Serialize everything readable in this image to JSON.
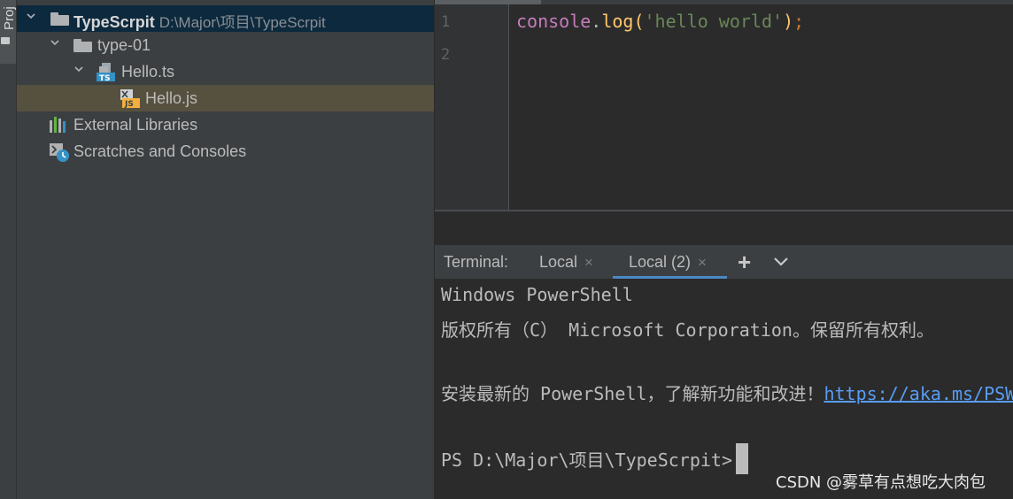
{
  "tool_window_tab": {
    "label": "Proj"
  },
  "project_tree": {
    "root": {
      "name": "TypeScrpit",
      "path": "D:\\Major\\项目\\TypeScrpit"
    },
    "folder": {
      "name": "type-01"
    },
    "ts_file": {
      "name": "Hello.ts",
      "badge": "TS"
    },
    "js_file": {
      "name": "Hello.js",
      "badge": "JS"
    },
    "external_libraries": "External Libraries",
    "scratches": "Scratches and Consoles"
  },
  "editor": {
    "line_numbers": [
      "1",
      "2"
    ],
    "code_tokens": {
      "obj": "console",
      "dot": ".",
      "fn": "log",
      "open": "(",
      "str": "'hello world'",
      "close": ")",
      "semi": ";"
    }
  },
  "terminal": {
    "title": "Terminal:",
    "tabs": [
      {
        "label": "Local",
        "close": "×"
      },
      {
        "label": "Local (2)",
        "close": "×"
      }
    ],
    "add_label": "+",
    "lines": {
      "l1": "Windows PowerShell",
      "l2": "版权所有（C） Microsoft Corporation。保留所有权利。",
      "l3_text": "安装最新的 PowerShell，了解新功能和改进！",
      "l3_link": "https://aka.ms/PSWindows",
      "prompt": "PS D:\\Major\\项目\\TypeScrpit>"
    }
  },
  "watermark": "CSDN @雾草有点想吃大肉包",
  "colors": {
    "panel_bg": "#3c3f41",
    "editor_bg": "#2b2b2b",
    "selection_bg": "#56503f",
    "root_bg": "#0d293e",
    "accent": "#4a88c7"
  }
}
